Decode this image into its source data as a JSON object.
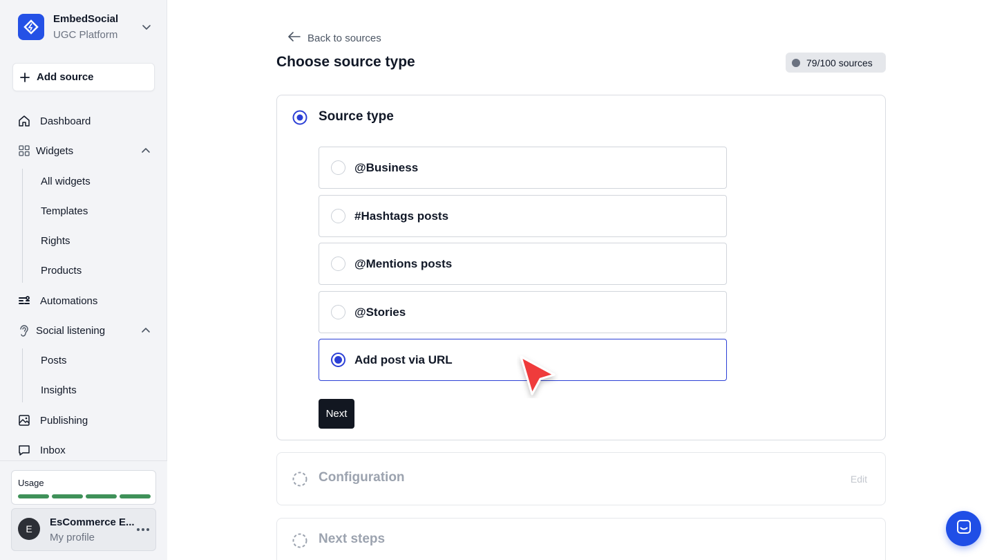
{
  "brand": {
    "name": "EmbedSocial",
    "subtitle": "UGC Platform"
  },
  "sidebar": {
    "add_source_label": "Add source",
    "nav": {
      "dashboard": "Dashboard",
      "widgets": "Widgets",
      "widgets_sub": [
        "All widgets",
        "Templates",
        "Rights",
        "Products"
      ],
      "automations": "Automations",
      "social_listening": "Social listening",
      "social_sub": [
        "Posts",
        "Insights"
      ],
      "publishing": "Publishing",
      "inbox": "Inbox"
    },
    "usage": {
      "label": "Usage",
      "segments": 4,
      "color": "#3f9159"
    },
    "profile": {
      "initial": "E",
      "name": "EsCommerce E...",
      "subtitle": "My profile"
    }
  },
  "main": {
    "back_label": "Back to sources",
    "title": "Choose source type",
    "sources_badge": "79/100 sources",
    "steps": {
      "source_type": {
        "title": "Source type",
        "options": [
          {
            "label": "@Business",
            "selected": false
          },
          {
            "label": "#Hashtags posts",
            "selected": false
          },
          {
            "label": "@Mentions posts",
            "selected": false
          },
          {
            "label": "@Stories",
            "selected": false
          },
          {
            "label": "Add post via URL",
            "selected": true
          }
        ],
        "next_label": "Next"
      },
      "configuration": {
        "title": "Configuration",
        "edit_label": "Edit"
      },
      "next_steps": {
        "title": "Next steps"
      }
    }
  },
  "colors": {
    "accent": "#2b3fd6",
    "brand": "#2451e6",
    "cursor": "#ef3b3b"
  }
}
